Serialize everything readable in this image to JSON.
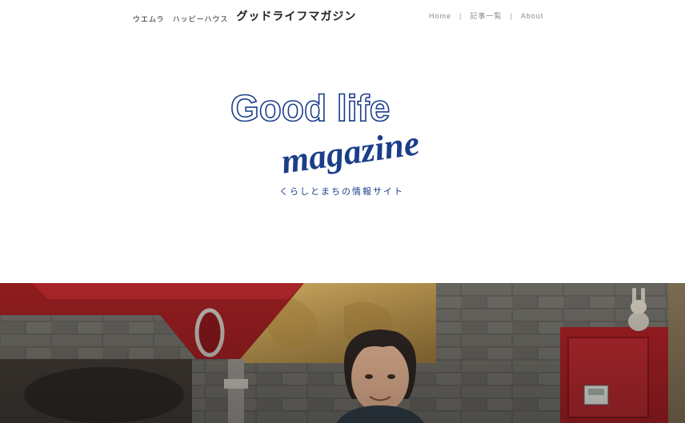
{
  "header": {
    "brand_small_1": "ウエムラ",
    "brand_small_2": "ハッピーハウス",
    "brand_big": "グッドライフマガジン"
  },
  "nav": {
    "items": [
      {
        "label": "Home"
      },
      {
        "label": "記事一覧"
      },
      {
        "label": "About"
      }
    ]
  },
  "logo": {
    "line1": "Good life",
    "line2": "magazine",
    "tagline": "くらしとまちの情報サイト"
  },
  "colors": {
    "brand_blue": "#1b3e8a",
    "nav_text": "#8a8a8a"
  }
}
